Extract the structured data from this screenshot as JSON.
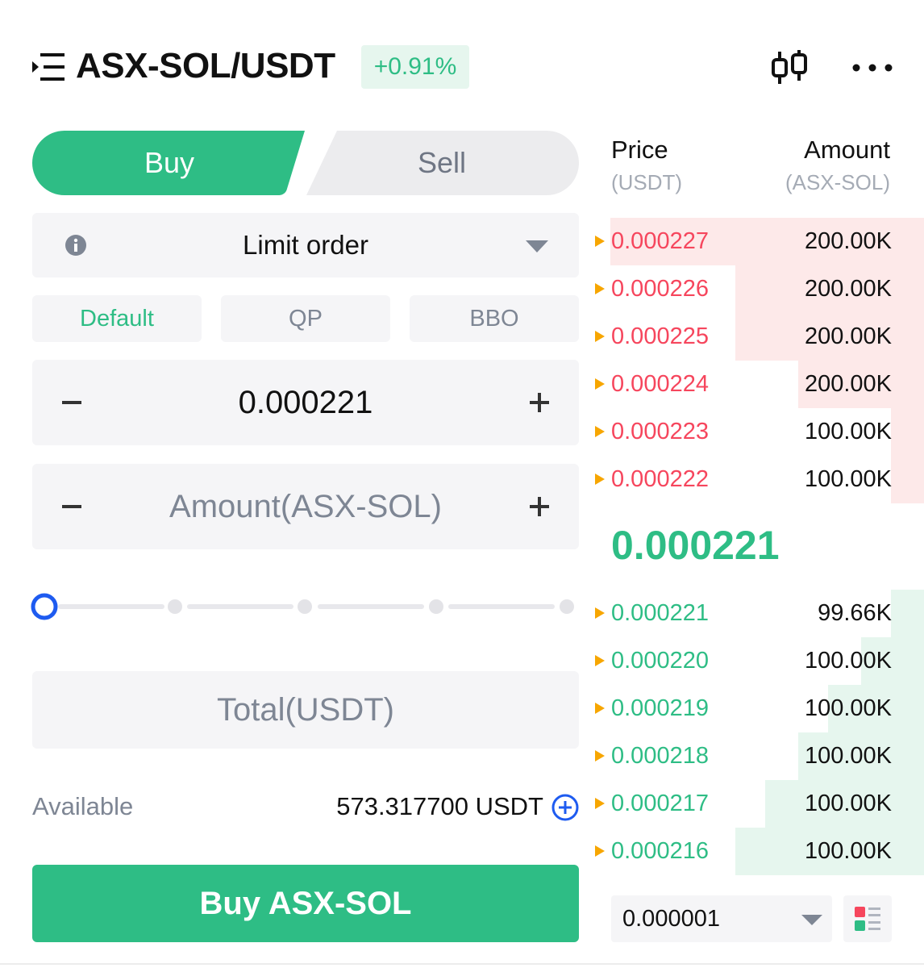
{
  "header": {
    "pair": "ASX-SOL/USDT",
    "change": "+0.91%"
  },
  "tabs": {
    "buy": "Buy",
    "sell": "Sell"
  },
  "order_type": {
    "label": "Limit order"
  },
  "subtabs": [
    {
      "label": "Default",
      "active": true
    },
    {
      "label": "QP",
      "active": false
    },
    {
      "label": "BBO",
      "active": false
    }
  ],
  "price_input": {
    "value": "0.000221"
  },
  "amount_input": {
    "placeholder": "Amount(ASX-SOL)"
  },
  "slider": {
    "value_fraction": 0,
    "stops": 5
  },
  "total_input": {
    "placeholder": "Total(USDT)"
  },
  "available": {
    "label": "Available",
    "value": "573.317700 USDT"
  },
  "submit": {
    "label": "Buy ASX-SOL"
  },
  "orderbook": {
    "price_header": "Price",
    "price_unit": "(USDT)",
    "amount_header": "Amount",
    "amount_unit": "(ASX-SOL)",
    "asks": [
      {
        "price": "0.000227",
        "amount": "200.00K",
        "depth": 0.95
      },
      {
        "price": "0.000226",
        "amount": "200.00K",
        "depth": 0.57
      },
      {
        "price": "0.000225",
        "amount": "200.00K",
        "depth": 0.57
      },
      {
        "price": "0.000224",
        "amount": "200.00K",
        "depth": 0.38
      },
      {
        "price": "0.000223",
        "amount": "100.00K",
        "depth": 0.1
      },
      {
        "price": "0.000222",
        "amount": "100.00K",
        "depth": 0.1
      }
    ],
    "last_price": "0.000221",
    "bids": [
      {
        "price": "0.000221",
        "amount": "99.66K",
        "depth": 0.1
      },
      {
        "price": "0.000220",
        "amount": "100.00K",
        "depth": 0.19
      },
      {
        "price": "0.000219",
        "amount": "100.00K",
        "depth": 0.29
      },
      {
        "price": "0.000218",
        "amount": "100.00K",
        "depth": 0.38
      },
      {
        "price": "0.000217",
        "amount": "100.00K",
        "depth": 0.48
      },
      {
        "price": "0.000216",
        "amount": "100.00K",
        "depth": 0.57
      }
    ],
    "precision": "0.000001"
  },
  "colors": {
    "green": "#2ebd85",
    "red": "#f6465d",
    "field_bg": "#f5f5f7",
    "marker": "#f7a600",
    "slider_blue": "#1e5bf0"
  }
}
